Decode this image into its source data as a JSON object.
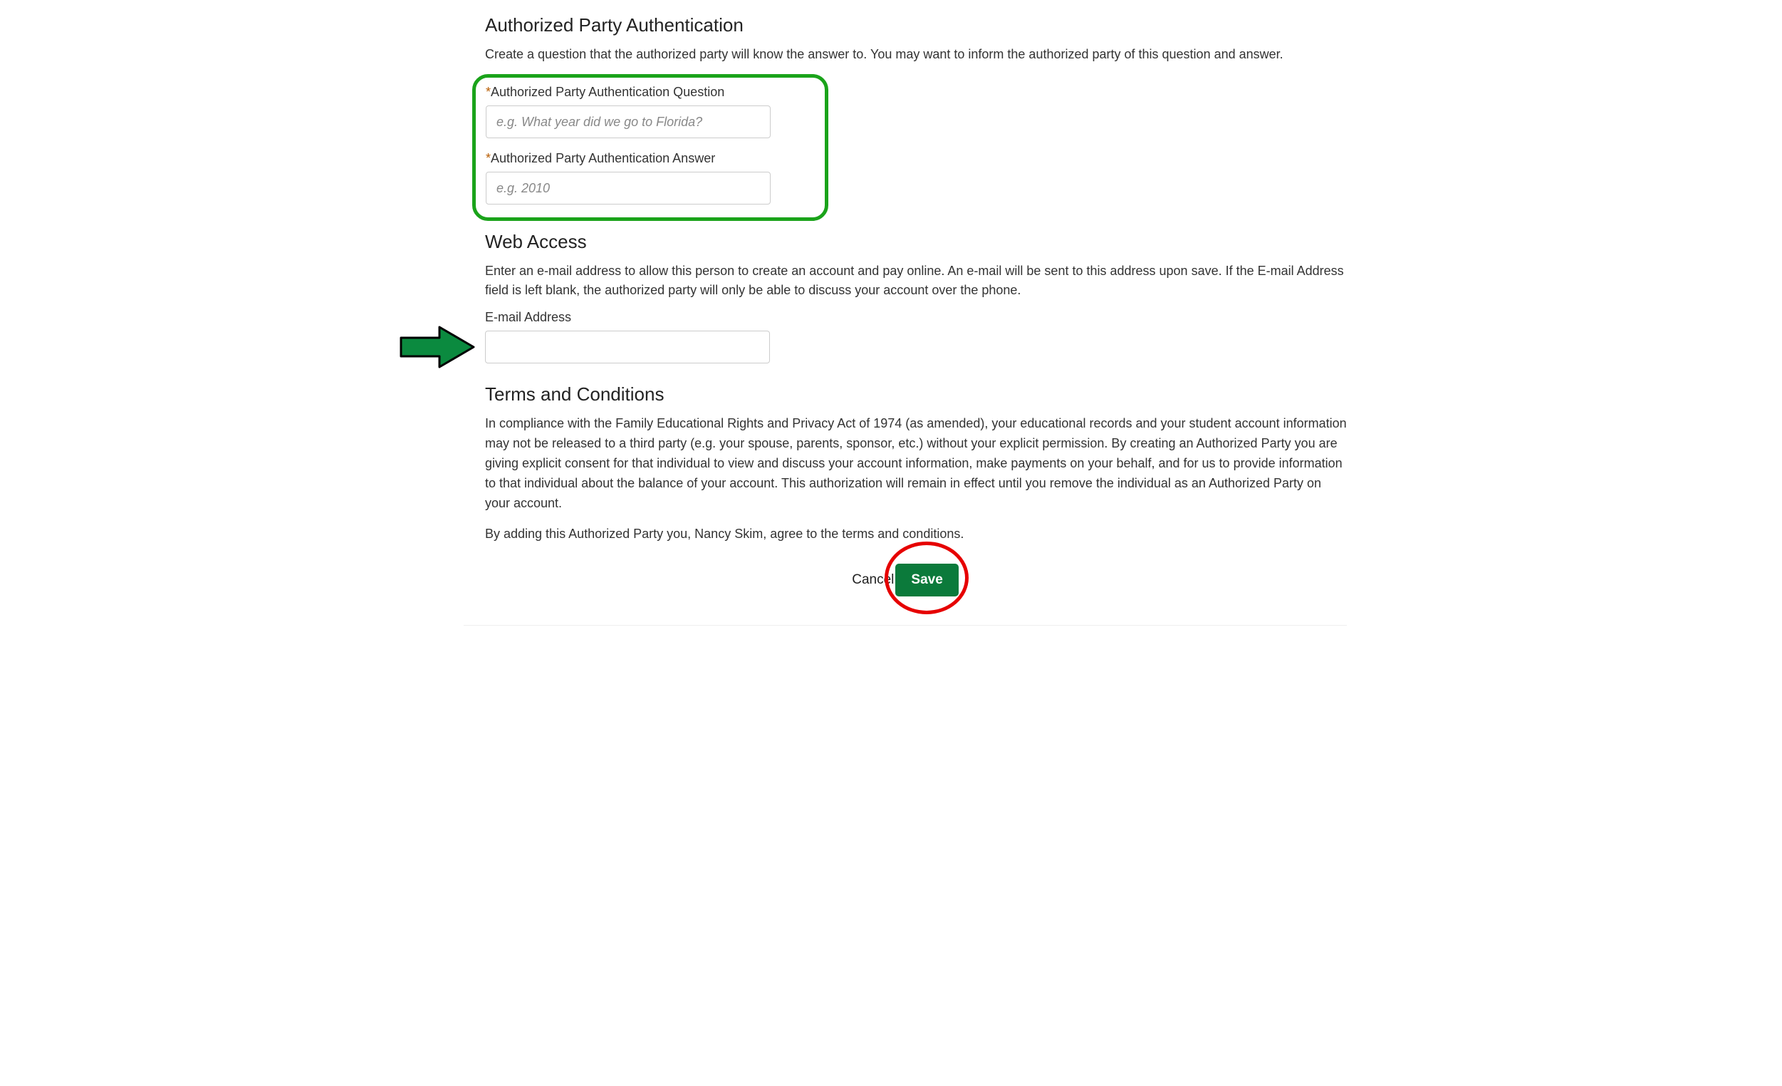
{
  "authentication": {
    "heading": "Authorized Party Authentication",
    "description": "Create a question that the authorized party will know the answer to. You may want to inform the authorized party of this question and answer.",
    "question_label": "Authorized Party Authentication Question",
    "question_placeholder": "e.g. What year did we go to Florida?",
    "question_value": "",
    "answer_label": "Authorized Party Authentication Answer",
    "answer_placeholder": "e.g. 2010",
    "answer_value": ""
  },
  "web_access": {
    "heading": "Web Access",
    "description": "Enter an e-mail address to allow this person to create an account and pay online. An e-mail will be sent to this address upon save. If the E-mail Address field is left blank, the authorized party will only be able to discuss your account over the phone.",
    "email_label": "E-mail Address",
    "email_value": ""
  },
  "terms": {
    "heading": "Terms and Conditions",
    "body": "In compliance with the Family Educational Rights and Privacy Act of 1974 (as amended), your educational records and your student account information may not be released to a third party (e.g. your spouse, parents, sponsor, etc.) without your explicit permission. By creating an Authorized Party you are giving explicit consent for that individual to view and discuss your account information, make payments on your behalf, and for us to provide information to that individual about the balance of your account. This authorization will remain in effect until you remove the individual as an Authorized Party on your account.",
    "agreement": "By adding this Authorized Party you, Nancy Skim, agree to the terms and conditions."
  },
  "actions": {
    "cancel_label": "Cancel",
    "save_label": "Save"
  },
  "annotations": {
    "highlight_color": "#1aa31a",
    "arrow_color": "#0b8a3f",
    "circle_color": "#e60000"
  }
}
